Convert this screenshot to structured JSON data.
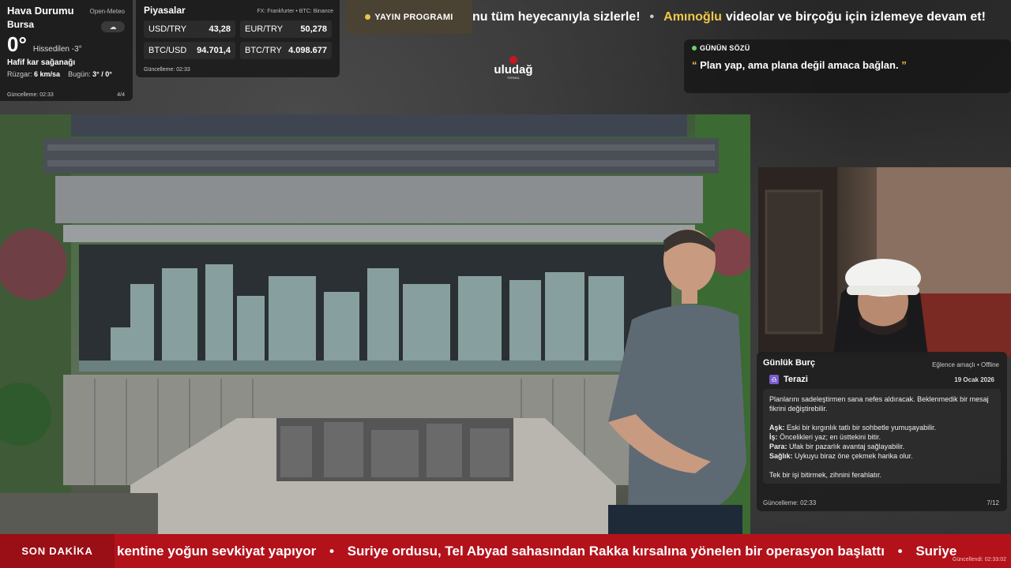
{
  "weather": {
    "title": "Hava Durumu",
    "source": "Open-Meteo",
    "city": "Bursa",
    "temperature": "0°",
    "feels_like": "Hissedilen -3°",
    "condition": "Hafif kar sağanağı",
    "wind_label": "Rüzgar:",
    "wind_value": "6 km/sa",
    "today_label": "Bugün:",
    "today_value": "3° / 0°",
    "updated": "Güncelleme: 02:33",
    "page": "4/4",
    "icon": "snow-cloud-icon"
  },
  "markets": {
    "title": "Piyasalar",
    "source": "FX: Frankfurter • BTC: Binance",
    "items": [
      {
        "label": "USD/TRY",
        "value": "43,28"
      },
      {
        "label": "EUR/TRY",
        "value": "50,278"
      },
      {
        "label": "BTC/USD",
        "value": "94.701,4"
      },
      {
        "label": "BTC/TRY",
        "value": "4.098.677"
      }
    ],
    "updated": "Güncelleme: 02:33"
  },
  "schedule": {
    "label": "YAYIN PROGRAMI",
    "dot_color": "#e6c452"
  },
  "top_ticker": {
    "text1": "nu tüm heyecanıyla sizlerle!",
    "separator": "•",
    "highlight": "Amınoğlu",
    "text2": "videolar ve birçoğu için izlemeye devam et!"
  },
  "logo": {
    "text": "uludağ",
    "subtext": "TERMAL"
  },
  "quote": {
    "label": "GÜNÜN SÖZÜ",
    "open": "“",
    "text": "Plan yap, ama plana değil amaca bağlan.",
    "close": "”"
  },
  "horoscope": {
    "title": "Günlük Burç",
    "tag": "Eğlence amaçlı • Offline",
    "sign_icon": "♎",
    "sign": "Terazi",
    "date": "19 Ocak 2026",
    "intro": "Planlarını sadeleştirmen sana nefes aldıracak. Beklenmedik bir mesaj fikrini değiştirebilir.",
    "lines": [
      {
        "label": "Aşk:",
        "text": "Eski bir kırgınlık tatlı bir sohbetle yumuşayabilir."
      },
      {
        "label": "İş:",
        "text": "Öncelikleri yaz; en üsttekini bitir."
      },
      {
        "label": "Para:",
        "text": "Ufak bir pazarlık avantaj sağlayabilir."
      },
      {
        "label": "Sağlık:",
        "text": "Uykuyu biraz öne çekmek harika olur."
      }
    ],
    "outro": "Tek bir işi bitirmek, zihnini ferahlatır.",
    "updated": "Güncelleme: 02:33",
    "page": "7/12"
  },
  "news": {
    "label": "SON DAKİKA",
    "item1": "kentine yoğun sevkiyat yapıyor",
    "separator": "•",
    "item2": "Suriye ordusu, Tel Abyad sahasından Rakka kırsalına yönelen bir operasyon başlattı",
    "item3": "Suriye",
    "updated": "Güncellendi: 02:33:02"
  }
}
